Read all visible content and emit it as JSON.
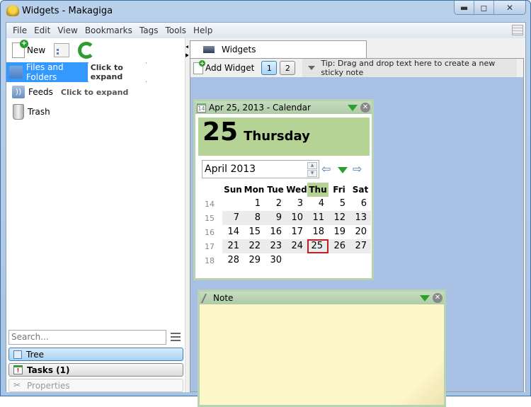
{
  "window": {
    "title": "Widgets - Makagiga",
    "controls": {
      "minimize": "▬",
      "maximize": "◻",
      "close": "✕"
    }
  },
  "menu": [
    "File",
    "Edit",
    "View",
    "Bookmarks",
    "Tags",
    "Tools",
    "Help"
  ],
  "toolbar": {
    "new_label": "New"
  },
  "tree": {
    "items": [
      {
        "label": "Files and Folders",
        "hint": "Click to expand",
        "icon": "folder-icon"
      },
      {
        "label": "Feeds",
        "hint": "Click to expand",
        "icon": "feed-icon"
      },
      {
        "label": "Trash",
        "icon": "trash-icon"
      }
    ]
  },
  "search": {
    "placeholder": "Search..."
  },
  "panels": {
    "tree": "Tree",
    "tasks": "Tasks (1)",
    "properties": "Properties"
  },
  "tab": {
    "label": "Widgets"
  },
  "widget_toolbar": {
    "add_label": "Add Widget",
    "pages": [
      "1",
      "2"
    ],
    "active_page": "1",
    "tip": "Tip: Drag and drop text here to create a new sticky note"
  },
  "calendar": {
    "title": "Apr 25, 2013 - Calendar",
    "icon_day": "14",
    "day": "25",
    "weekday": "Thursday",
    "month": "April 2013",
    "headers": [
      "Sun",
      "Mon",
      "Tue",
      "Wed",
      "Thu",
      "Fri",
      "Sat"
    ],
    "today_col": 4,
    "weeks": [
      {
        "wk": "14",
        "days": [
          "",
          "1",
          "2",
          "3",
          "4",
          "5",
          "6"
        ]
      },
      {
        "wk": "15",
        "days": [
          "7",
          "8",
          "9",
          "10",
          "11",
          "12",
          "13"
        ]
      },
      {
        "wk": "16",
        "days": [
          "14",
          "15",
          "16",
          "17",
          "18",
          "19",
          "20"
        ]
      },
      {
        "wk": "17",
        "days": [
          "21",
          "22",
          "23",
          "24",
          "25",
          "26",
          "27"
        ]
      },
      {
        "wk": "18",
        "days": [
          "28",
          "29",
          "30",
          "",
          "",
          "",
          ""
        ]
      }
    ],
    "selected": "25"
  },
  "note": {
    "title": "Note",
    "text": ""
  },
  "colors": {
    "selection": "#3399ff",
    "widget_header": "#aecba6",
    "date_box": "#b5d394",
    "note_bg": "#fdf5c7",
    "desktop": "#a7c0e3",
    "selected_day_border": "#c02020"
  }
}
